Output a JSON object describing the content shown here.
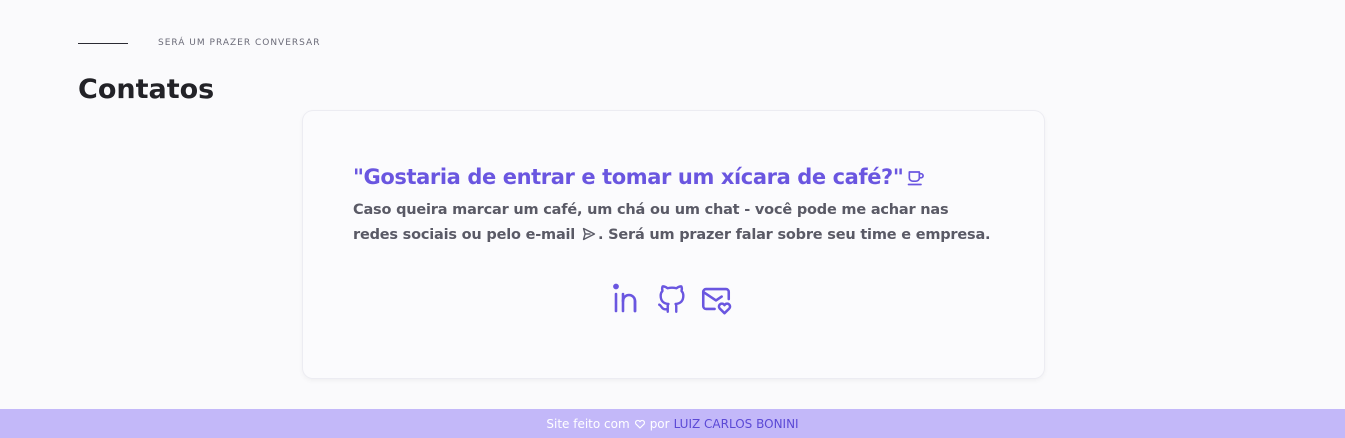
{
  "section": {
    "eyebrow": "SERÁ UM PRAZER CONVERSAR",
    "title": "Contatos"
  },
  "card": {
    "quote": "\"Gostaria de entrar e tomar um xícara de café?\"",
    "quote_icon": "coffee-cup-icon",
    "description_part1": "Caso queira marcar um café, um chá ou um chat - você pode me achar nas redes sociais ou pelo e-mail",
    "description_icon": "send-icon",
    "description_part2": ". Será um prazer falar sobre seu time e empresa.",
    "socials": [
      {
        "name": "LinkedIn",
        "icon": "linkedin-icon"
      },
      {
        "name": "GitHub",
        "icon": "github-icon"
      },
      {
        "name": "E-mail",
        "icon": "mail-heart-icon"
      }
    ]
  },
  "footer": {
    "text_before": "Site feito com",
    "text_middle": "por",
    "author": "LUIZ CARLOS BONINI"
  },
  "colors": {
    "accent": "#6a56e0",
    "footer_bg": "#c3b8f9",
    "footer_link": "#5b49d6",
    "text_muted": "#5a5a66"
  }
}
